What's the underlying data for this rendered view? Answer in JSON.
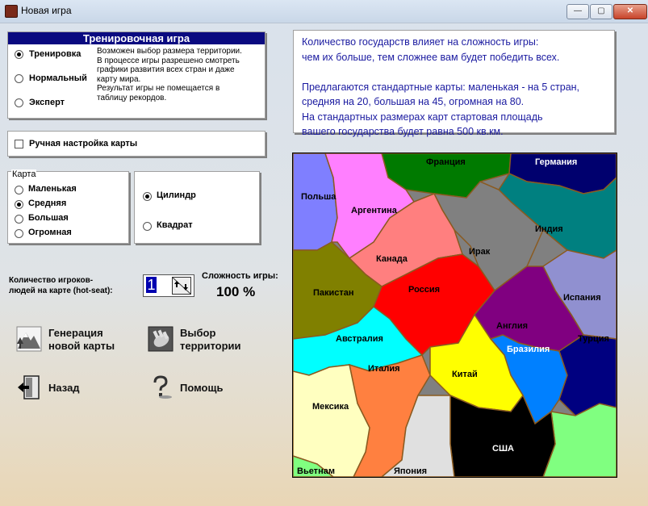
{
  "window": {
    "title": "Новая игра",
    "minimize": "—",
    "maximize": "▢",
    "close": "✕"
  },
  "training": {
    "header": "Тренировочная игра",
    "modes": [
      {
        "label": "Тренировка",
        "selected": true
      },
      {
        "label": "Нормальный",
        "selected": false
      },
      {
        "label": "Эксперт",
        "selected": false
      }
    ],
    "description": "Возможен выбор размера территории.\nВ процессе игры разрешено смотреть\nграфики развития всех стран и даже\nкарту мира.\nРезультат игры не помещается в\nтаблицу рекордов."
  },
  "manual_map": {
    "label": "Ручная настройка карты",
    "checked": false
  },
  "map_size": {
    "title": "Карта",
    "options": [
      {
        "label": "Маленькая",
        "selected": false
      },
      {
        "label": "Средняя",
        "selected": true
      },
      {
        "label": "Большая",
        "selected": false
      },
      {
        "label": "Огромная",
        "selected": false
      }
    ]
  },
  "topology": {
    "options": [
      {
        "label": "Цилиндр",
        "selected": true
      },
      {
        "label": "Квадрат",
        "selected": false
      }
    ]
  },
  "players": {
    "label": "Количество игроков-\nлюдей на карте (hot-seat):",
    "value": "1",
    "arrows": "↑↓"
  },
  "difficulty": {
    "label": "Сложность игры:",
    "value": "100 %"
  },
  "actions": {
    "generate": {
      "label": "Генерация\nновой карты",
      "icon": "mountains-icon"
    },
    "select_territory": {
      "label": "Выбор\nтерритории",
      "icon": "hand-icon"
    },
    "back": {
      "label": "Назад",
      "icon": "exit-door-icon"
    },
    "help": {
      "label": "Помощь",
      "icon": "question-mark-icon"
    }
  },
  "info": {
    "text": "Количество государств влияет на сложность игры:\nчем их больше, тем сложнее вам будет победить всех.\n\nПредлагаются стандартные карты: маленькая - на 5 стран,\nсредняя на 20, большая на 45, огромная на 80.\nНа стандартных размерах карт стартовая площадь\nвашего государства будет равна 500 кв.км."
  },
  "map": {
    "countries": [
      {
        "name": "Франция",
        "color": "#007a00"
      },
      {
        "name": "Германия",
        "color": "#00006e"
      },
      {
        "name": "Польша",
        "color": "#7f7fff"
      },
      {
        "name": "Аргентина",
        "color": "#ff7fff"
      },
      {
        "name": "Индия",
        "color": "#008080"
      },
      {
        "name": "Ирак",
        "color": "#808080"
      },
      {
        "name": "Канада",
        "color": "#ff7f7f"
      },
      {
        "name": "Пакистан",
        "color": "#808000"
      },
      {
        "name": "Россия",
        "color": "#ff0000"
      },
      {
        "name": "Испания",
        "color": "#9090d0"
      },
      {
        "name": "Англия",
        "color": "#800080"
      },
      {
        "name": "Австралия",
        "color": "#00ffff"
      },
      {
        "name": "Бразилия",
        "color": "#0080ff"
      },
      {
        "name": "Турция",
        "color": "#000080"
      },
      {
        "name": "Италия",
        "color": "#ff8040"
      },
      {
        "name": "Китай",
        "color": "#ffff00"
      },
      {
        "name": "Мексика",
        "color": "#ffffc0"
      },
      {
        "name": "США",
        "color": "#000000"
      },
      {
        "name": "Вьетнам",
        "color": "#80ff80"
      },
      {
        "name": "Япония",
        "color": "#e0e0e0"
      }
    ]
  }
}
